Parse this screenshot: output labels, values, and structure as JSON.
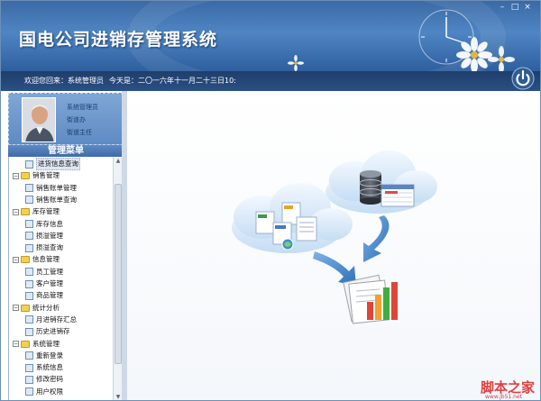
{
  "app": {
    "title": "国电公司进销存管理系统"
  },
  "statusbar": {
    "welcome": "欢迎您回来：系统管理员",
    "date": "今天是：二〇一六年十一月二十三日",
    "time": "10:"
  },
  "profile": {
    "role": "系统管理员",
    "office": "街道办",
    "title": "街道主任"
  },
  "menu": {
    "header": "管理菜单",
    "items": [
      {
        "label": "进货信息查询",
        "level": 2,
        "selected": true
      },
      {
        "label": "销售管理",
        "level": 1
      },
      {
        "label": "销售账单管理",
        "level": 2
      },
      {
        "label": "销售账单查询",
        "level": 2
      },
      {
        "label": "库存管理",
        "level": 1
      },
      {
        "label": "库存信息",
        "level": 2
      },
      {
        "label": "损溢管理",
        "level": 2
      },
      {
        "label": "损溢查询",
        "level": 2
      },
      {
        "label": "信息管理",
        "level": 1
      },
      {
        "label": "员工管理",
        "level": 2
      },
      {
        "label": "客户管理",
        "level": 2
      },
      {
        "label": "商品管理",
        "level": 2
      },
      {
        "label": "统计分析",
        "level": 1
      },
      {
        "label": "月进销存汇总",
        "level": 2
      },
      {
        "label": "历史进销存",
        "level": 2
      },
      {
        "label": "系统管理",
        "level": 1
      },
      {
        "label": "重新登录",
        "level": 2
      },
      {
        "label": "系统信息",
        "level": 2
      },
      {
        "label": "修改密码",
        "level": 2
      },
      {
        "label": "用户权限",
        "level": 2
      }
    ]
  },
  "watermark": {
    "text": "脚本之家",
    "url": "www.jb51.net"
  },
  "colors": {
    "banner": "#3b6aa5",
    "statusbar": "#1f3e6b",
    "folder": "#f3cf55"
  }
}
